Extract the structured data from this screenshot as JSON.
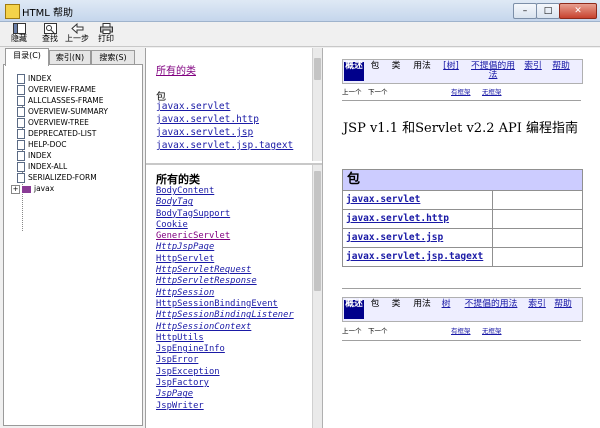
{
  "window": {
    "title": "HTML 帮助",
    "min": "–",
    "max": "□",
    "close": "✕"
  },
  "toolbar": {
    "hide": "隐藏",
    "find": "查找",
    "back": "上一步",
    "print": "打印"
  },
  "tabs": [
    {
      "label": "目录(C)"
    },
    {
      "label": "索引(N)"
    },
    {
      "label": "搜索(S)"
    }
  ],
  "tree": {
    "items": [
      "INDEX",
      "OVERVIEW-FRAME",
      "ALLCLASSES-FRAME",
      "OVERVIEW-SUMMARY",
      "OVERVIEW-TREE",
      "DEPRECATED-LIST",
      "HELP-DOC",
      "INDEX",
      "INDEX-ALL",
      "SERIALIZED-FORM"
    ],
    "folder": "javax",
    "expand": "+"
  },
  "overview_frame": {
    "all_classes_link": "所有的类",
    "packages_heading": "包",
    "packages": [
      "javax.servlet",
      "javax.servlet.http",
      "javax.servlet.jsp",
      "javax.servlet.jsp.tagext"
    ]
  },
  "classes_frame": {
    "title": "所有的类",
    "classes": [
      "BodyContent",
      "BodyTag",
      "BodyTagSupport",
      "Cookie",
      "GenericServlet",
      "HttpJspPage",
      "HttpServlet",
      "HttpServletRequest",
      "HttpServletResponse",
      "HttpSession",
      "HttpSessionBindingEvent",
      "HttpSessionBindingListener",
      "HttpSessionContext",
      "HttpUtils",
      "JspEngineInfo",
      "JspError",
      "JspException",
      "JspFactory",
      "JspPage",
      "JspWriter"
    ]
  },
  "main_frame": {
    "navbar": {
      "overview": "概述",
      "package": "包",
      "class": "类",
      "use": "用法",
      "tree": "[树]",
      "deprecated": "不提倡的用法",
      "index": "索引",
      "help": "帮助"
    },
    "navbar_bottom": {
      "overview": "概述",
      "package": "包",
      "class": "类",
      "use": "用法",
      "tree": "树",
      "deprecated": "不提倡的用法",
      "index": "索引",
      "help": "帮助"
    },
    "prev": "上一个",
    "next": "下一个",
    "frames": "有框架",
    "noframes": "无框架",
    "title": "JSP v1.1 和Servlet v2.2 API 编程指南",
    "table_header": "包",
    "packages": [
      "javax.servlet",
      "javax.servlet.http",
      "javax.servlet.jsp",
      "javax.servlet.jsp.tagext"
    ]
  }
}
